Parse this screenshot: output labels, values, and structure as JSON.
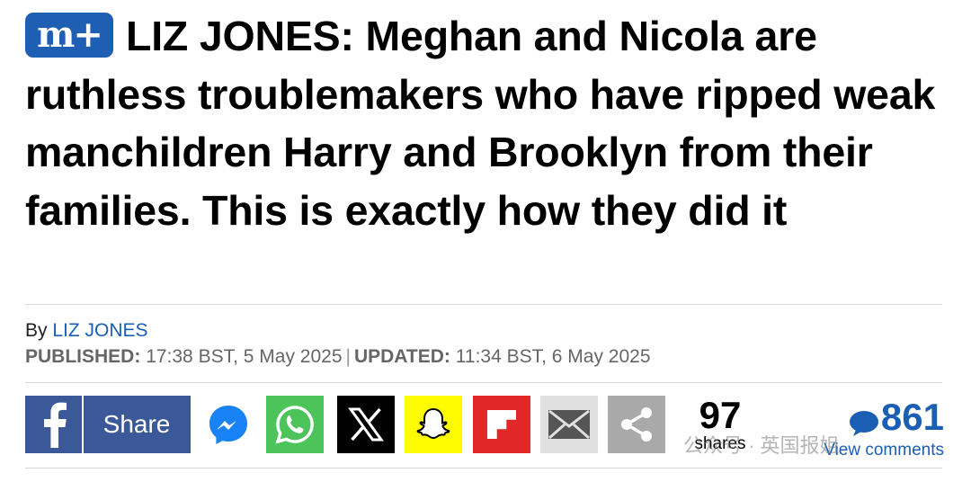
{
  "badge": {
    "text": "m+"
  },
  "headline": "LIZ JONES: Meghan and Nicola are ruthless troublemakers who have ripped weak manchildren Harry and Brooklyn from their families. This is exactly how they did it",
  "byline": {
    "prefix": "By",
    "author": "LIZ JONES"
  },
  "published": {
    "label": "PUBLISHED:",
    "value": "17:38 BST, 5 May 2025"
  },
  "updated": {
    "label": "UPDATED:",
    "value": "11:34 BST, 6 May 2025"
  },
  "share": {
    "facebook_label": "Share",
    "buttons": [
      {
        "name": "messenger",
        "icon": "messenger-icon",
        "color": "#ffffff"
      },
      {
        "name": "whatsapp",
        "icon": "whatsapp-icon",
        "color": "#4cc459"
      },
      {
        "name": "x",
        "icon": "x-icon",
        "color": "#000000"
      },
      {
        "name": "snapchat",
        "icon": "snapchat-icon",
        "color": "#fffc00"
      },
      {
        "name": "flipboard",
        "icon": "flipboard-icon",
        "color": "#e12828"
      },
      {
        "name": "email",
        "icon": "email-icon",
        "color": "#e0e0e0"
      },
      {
        "name": "more-share",
        "icon": "share-icon",
        "color": "#a9a9a9"
      }
    ],
    "count": "97",
    "count_label": "shares"
  },
  "comments": {
    "count": "861",
    "label": "View comments"
  },
  "watermark": "公众号 · 英国报姐",
  "colors": {
    "brand_blue": "#1f5fb3",
    "link_blue": "#1b5fb5",
    "facebook": "#3b5998"
  }
}
